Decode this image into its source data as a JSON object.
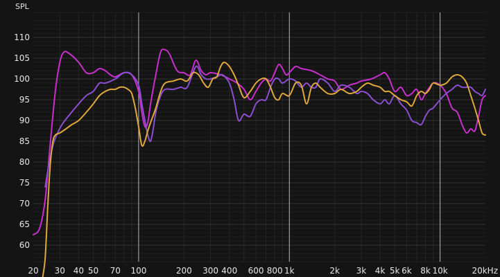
{
  "chart_data": {
    "type": "line",
    "title": "",
    "ylabel": "SPL",
    "xlabel": "",
    "x_scale": "log",
    "xlim": [
      20,
      20000
    ],
    "ylim": [
      56,
      116
    ],
    "grid": true,
    "legend": "none",
    "background": "#141414",
    "yticks": [
      60,
      65,
      70,
      75,
      80,
      85,
      90,
      95,
      100,
      105,
      110
    ],
    "xticks": [
      {
        "value": 20,
        "label": "20"
      },
      {
        "value": 30,
        "label": "30"
      },
      {
        "value": 40,
        "label": "40"
      },
      {
        "value": 50,
        "label": "50"
      },
      {
        "value": 70,
        "label": "70"
      },
      {
        "value": 100,
        "label": "100"
      },
      {
        "value": 200,
        "label": "200"
      },
      {
        "value": 300,
        "label": "300"
      },
      {
        "value": 400,
        "label": "400"
      },
      {
        "value": 600,
        "label": "600"
      },
      {
        "value": 800,
        "label": "800"
      },
      {
        "value": 1000,
        "label": "1k"
      },
      {
        "value": 2000,
        "label": "2k"
      },
      {
        "value": 3000,
        "label": "3k"
      },
      {
        "value": 4000,
        "label": "4k"
      },
      {
        "value": 5000,
        "label": "5k"
      },
      {
        "value": 6000,
        "label": "6k"
      },
      {
        "value": 8000,
        "label": "8k"
      },
      {
        "value": 10000,
        "label": "10k"
      },
      {
        "value": 20000,
        "label": "20kHz"
      }
    ],
    "series": [
      {
        "color": "#c92ecf",
        "points": [
          [
            20,
            62.5
          ],
          [
            22,
            64
          ],
          [
            24,
            71
          ],
          [
            26,
            85
          ],
          [
            28,
            97
          ],
          [
            30,
            104
          ],
          [
            32,
            106.5
          ],
          [
            35,
            106
          ],
          [
            40,
            104
          ],
          [
            45,
            101.5
          ],
          [
            50,
            101.5
          ],
          [
            55,
            102.5
          ],
          [
            60,
            102
          ],
          [
            65,
            101
          ],
          [
            70,
            100.5
          ],
          [
            80,
            101.5
          ],
          [
            90,
            101
          ],
          [
            100,
            97
          ],
          [
            105,
            92
          ],
          [
            110,
            88.5
          ],
          [
            115,
            89.5
          ],
          [
            120,
            94
          ],
          [
            130,
            101
          ],
          [
            140,
            106.5
          ],
          [
            150,
            107
          ],
          [
            160,
            106
          ],
          [
            180,
            102
          ],
          [
            200,
            101.5
          ],
          [
            220,
            101
          ],
          [
            240,
            104.5
          ],
          [
            260,
            102
          ],
          [
            280,
            101
          ],
          [
            300,
            101.5
          ],
          [
            350,
            101
          ],
          [
            400,
            100
          ],
          [
            450,
            99
          ],
          [
            500,
            97.5
          ],
          [
            550,
            95
          ],
          [
            600,
            97
          ],
          [
            650,
            99
          ],
          [
            700,
            100
          ],
          [
            750,
            99.5
          ],
          [
            800,
            101.5
          ],
          [
            850,
            103.5
          ],
          [
            900,
            102.5
          ],
          [
            950,
            101
          ],
          [
            1000,
            101.5
          ],
          [
            1100,
            103
          ],
          [
            1200,
            102.5
          ],
          [
            1400,
            102
          ],
          [
            1600,
            101
          ],
          [
            1800,
            100
          ],
          [
            2000,
            99.5
          ],
          [
            2200,
            97.5
          ],
          [
            2500,
            98.5
          ],
          [
            2800,
            99
          ],
          [
            3000,
            99.5
          ],
          [
            3500,
            100
          ],
          [
            4000,
            101
          ],
          [
            4300,
            101.5
          ],
          [
            4600,
            100
          ],
          [
            5000,
            97
          ],
          [
            5500,
            98
          ],
          [
            6000,
            96
          ],
          [
            6500,
            96.5
          ],
          [
            7000,
            97.5
          ],
          [
            7500,
            95
          ],
          [
            8000,
            96.5
          ],
          [
            9000,
            99
          ],
          [
            10000,
            98.5
          ],
          [
            11000,
            96.5
          ],
          [
            12000,
            93
          ],
          [
            13000,
            92
          ],
          [
            14000,
            89
          ],
          [
            15000,
            87
          ],
          [
            16000,
            88
          ],
          [
            17000,
            87.5
          ],
          [
            18000,
            91
          ],
          [
            19000,
            95
          ],
          [
            20000,
            96
          ]
        ]
      },
      {
        "color": "#8c4fd4",
        "points": [
          [
            24,
            74
          ],
          [
            25,
            78
          ],
          [
            27,
            84
          ],
          [
            29,
            87
          ],
          [
            31,
            89
          ],
          [
            35,
            91.5
          ],
          [
            40,
            94
          ],
          [
            45,
            96
          ],
          [
            50,
            97
          ],
          [
            55,
            99
          ],
          [
            60,
            99
          ],
          [
            70,
            100
          ],
          [
            80,
            101.5
          ],
          [
            90,
            101
          ],
          [
            100,
            98.5
          ],
          [
            105,
            94
          ],
          [
            110,
            90
          ],
          [
            115,
            86.5
          ],
          [
            120,
            85
          ],
          [
            125,
            88
          ],
          [
            130,
            92
          ],
          [
            140,
            96
          ],
          [
            150,
            97.5
          ],
          [
            170,
            97.5
          ],
          [
            190,
            98
          ],
          [
            210,
            98
          ],
          [
            240,
            103
          ],
          [
            260,
            101
          ],
          [
            280,
            100
          ],
          [
            300,
            100
          ],
          [
            330,
            100.5
          ],
          [
            360,
            101
          ],
          [
            400,
            99
          ],
          [
            430,
            95
          ],
          [
            460,
            90
          ],
          [
            500,
            91.5
          ],
          [
            550,
            91
          ],
          [
            600,
            94
          ],
          [
            650,
            95
          ],
          [
            700,
            95
          ],
          [
            750,
            98
          ],
          [
            800,
            100
          ],
          [
            850,
            100
          ],
          [
            900,
            99
          ],
          [
            1000,
            100
          ],
          [
            1100,
            99.5
          ],
          [
            1200,
            98
          ],
          [
            1300,
            99
          ],
          [
            1400,
            98
          ],
          [
            1500,
            98
          ],
          [
            1600,
            100
          ],
          [
            1800,
            99
          ],
          [
            2000,
            97
          ],
          [
            2200,
            98.5
          ],
          [
            2500,
            98
          ],
          [
            2800,
            96.5
          ],
          [
            3000,
            97
          ],
          [
            3300,
            96.5
          ],
          [
            3600,
            95
          ],
          [
            4000,
            94
          ],
          [
            4300,
            95
          ],
          [
            4600,
            94
          ],
          [
            5000,
            96
          ],
          [
            5500,
            94
          ],
          [
            6000,
            92.5
          ],
          [
            6500,
            90
          ],
          [
            7000,
            89.5
          ],
          [
            7500,
            89
          ],
          [
            8000,
            91
          ],
          [
            8500,
            92.5
          ],
          [
            9000,
            93
          ],
          [
            10000,
            95
          ],
          [
            11000,
            96.5
          ],
          [
            12000,
            97.5
          ],
          [
            13000,
            98.5
          ],
          [
            14000,
            98
          ],
          [
            15000,
            98
          ],
          [
            16000,
            98
          ],
          [
            17000,
            97
          ],
          [
            18000,
            96.5
          ],
          [
            19000,
            96
          ],
          [
            20000,
            97.5
          ]
        ]
      },
      {
        "color": "#e0a93a",
        "points": [
          [
            23,
            52
          ],
          [
            24,
            57
          ],
          [
            25,
            70
          ],
          [
            26,
            80
          ],
          [
            27,
            85
          ],
          [
            28,
            86.5
          ],
          [
            30,
            87
          ],
          [
            33,
            88
          ],
          [
            36,
            89
          ],
          [
            40,
            90
          ],
          [
            45,
            92
          ],
          [
            50,
            94
          ],
          [
            55,
            96
          ],
          [
            60,
            97
          ],
          [
            65,
            97.5
          ],
          [
            70,
            97.5
          ],
          [
            75,
            98
          ],
          [
            80,
            98
          ],
          [
            85,
            97.5
          ],
          [
            90,
            96.5
          ],
          [
            95,
            93
          ],
          [
            100,
            88.5
          ],
          [
            105,
            84
          ],
          [
            110,
            85
          ],
          [
            115,
            87.5
          ],
          [
            120,
            89.5
          ],
          [
            130,
            93
          ],
          [
            140,
            97
          ],
          [
            150,
            99
          ],
          [
            170,
            99.5
          ],
          [
            190,
            100
          ],
          [
            210,
            99.5
          ],
          [
            230,
            101.5
          ],
          [
            250,
            101
          ],
          [
            270,
            99
          ],
          [
            290,
            98
          ],
          [
            310,
            100
          ],
          [
            330,
            100.5
          ],
          [
            350,
            103
          ],
          [
            370,
            104
          ],
          [
            400,
            103
          ],
          [
            430,
            101
          ],
          [
            460,
            98.5
          ],
          [
            500,
            95.5
          ],
          [
            550,
            97
          ],
          [
            600,
            99
          ],
          [
            650,
            100
          ],
          [
            700,
            100
          ],
          [
            750,
            98
          ],
          [
            800,
            95.5
          ],
          [
            850,
            95
          ],
          [
            900,
            96.5
          ],
          [
            1000,
            96
          ],
          [
            1100,
            99
          ],
          [
            1200,
            98.5
          ],
          [
            1300,
            94
          ],
          [
            1400,
            98
          ],
          [
            1500,
            99
          ],
          [
            1600,
            98
          ],
          [
            1800,
            96.5
          ],
          [
            2000,
            96.5
          ],
          [
            2200,
            97.5
          ],
          [
            2500,
            96.5
          ],
          [
            2800,
            97
          ],
          [
            3000,
            98
          ],
          [
            3300,
            99
          ],
          [
            3600,
            98.5
          ],
          [
            4000,
            98
          ],
          [
            4300,
            97
          ],
          [
            4600,
            97
          ],
          [
            5000,
            96
          ],
          [
            5500,
            95
          ],
          [
            6000,
            94.5
          ],
          [
            6500,
            93.5
          ],
          [
            7000,
            96
          ],
          [
            7500,
            97
          ],
          [
            8000,
            96.5
          ],
          [
            8500,
            97.5
          ],
          [
            9000,
            99
          ],
          [
            10000,
            98.5
          ],
          [
            11000,
            99
          ],
          [
            12000,
            100.5
          ],
          [
            13000,
            101
          ],
          [
            14000,
            100.5
          ],
          [
            15000,
            99
          ],
          [
            16000,
            96
          ],
          [
            17000,
            93
          ],
          [
            18000,
            90
          ],
          [
            19000,
            87
          ],
          [
            20000,
            86.5
          ]
        ]
      }
    ]
  }
}
